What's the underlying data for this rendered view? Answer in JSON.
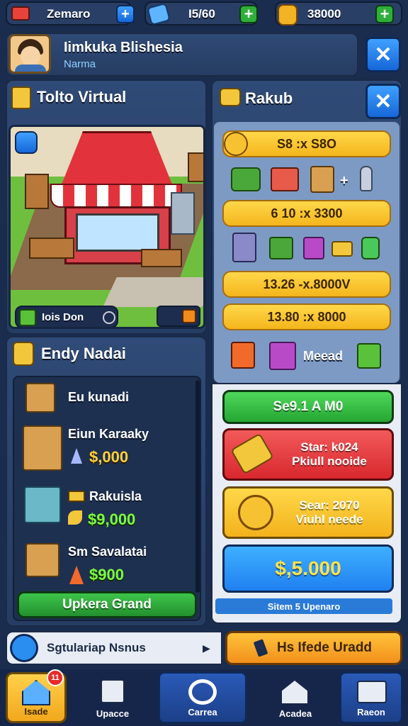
{
  "topbar": {
    "res1": "Zemaro",
    "res2": "I5/60",
    "res3": "38000"
  },
  "profile": {
    "name": "Iimkuka Blishesia",
    "subtitle": "Narma"
  },
  "left_panel": {
    "title": "Tolto Virtual",
    "shop_badge": "Iois Don"
  },
  "center_panel": {
    "title": "Endy Nadai",
    "items": [
      {
        "name": "Eu kunadi",
        "price": ""
      },
      {
        "name": "Eiun Karaaky",
        "price": "$,000"
      },
      {
        "name": "Rakuisla",
        "price": "$9,000"
      },
      {
        "name": "Sm Savalatai",
        "price": "$900"
      }
    ],
    "upgrade_button": "Upkera Grand"
  },
  "right_panel": {
    "title": "Rakub",
    "rows": [
      "S8 :x S8O",
      "6 10 :x 3300",
      "13.26 -x.8000V",
      "13.80 :x 8000"
    ],
    "misc_label": "Meead"
  },
  "actions": {
    "green_button": "Se9.1 A M0",
    "red_button_line1": "Star: k024",
    "red_button_line2": "Pkiull nooide",
    "gold_button_line1": "Sear: 2070",
    "gold_button_line2": "Viuhl neede",
    "blue_button": "$,5.000",
    "footer_label": "Sitem 5 Upenaro"
  },
  "bottom_bar": {
    "left_text": "Sgtulariap Nsnus",
    "right_button": "Hs Ifede Uradd"
  },
  "nav": {
    "items": [
      "Isade",
      "Upacce",
      "Carrea",
      "Acadea",
      "Raeon"
    ],
    "badge": "11"
  },
  "colors": {
    "background": "#1b2d4f",
    "gold": "#f4b51c",
    "green": "#39b54a",
    "red": "#e53b3b",
    "blue": "#1f8bff"
  }
}
